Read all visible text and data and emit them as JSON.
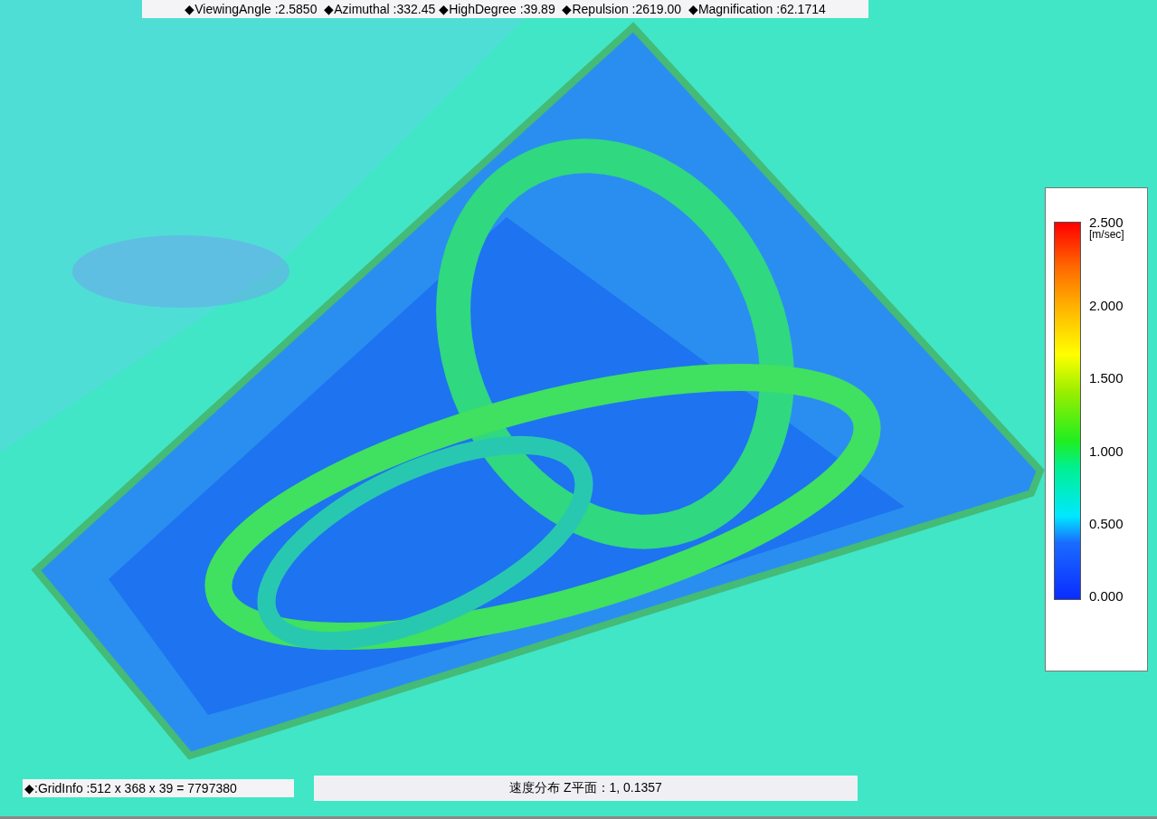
{
  "view_info": "◆ViewingAngle :2.5850  ◆Azimuthal :332.45 ◆HighDegree :39.89  ◆Repulsion :2619.00  ◆Magnification :62.1714",
  "legend": {
    "unit": "[m/sec]",
    "ticks": [
      "2.500",
      "2.000",
      "1.500",
      "1.000",
      "0.500",
      "0.000"
    ]
  },
  "grid_info": "◆:GridInfo :512 x 368 x 39 = 7797380",
  "plot_title": "速度分布 Z平面：1, 0.1357"
}
